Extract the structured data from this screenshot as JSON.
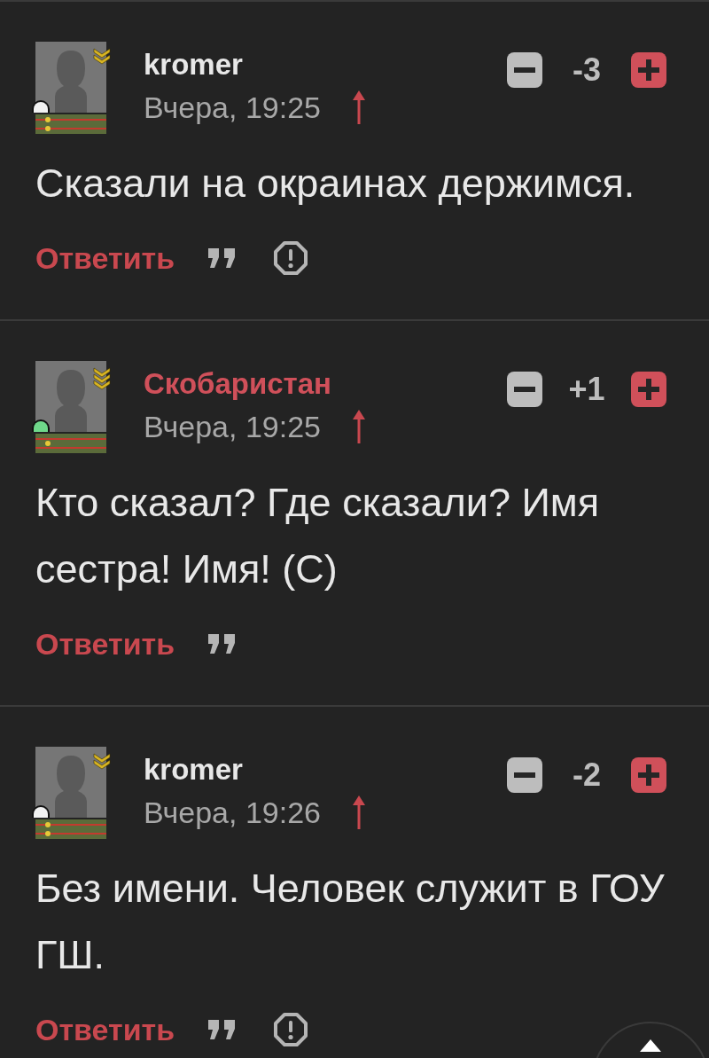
{
  "comments": [
    {
      "author": "kromer",
      "author_is_op": false,
      "time": "Вчера, 19:25",
      "kind": "lieutenant",
      "color": "#f2f2f2",
      "score": "-3",
      "text": "Сказали на окраинах держимся.",
      "reply": "Ответить",
      "report_button": true
    },
    {
      "author": "Скобаристан",
      "author_is_op": true,
      "time": "Вчера, 19:25",
      "kind": "ensign",
      "color": "#6fd88a",
      "score": "+1",
      "text": "Кто сказал? Где сказали? Имя сестра! Имя! (С)",
      "reply": "Ответить",
      "report_button": false
    },
    {
      "author": "kromer",
      "author_is_op": false,
      "time": "Вчера, 19:26",
      "kind": "lieutenant",
      "color": "#f2f2f2",
      "score": "-2",
      "text": "Без имени. Человек служит в ГОУ ГШ.",
      "reply": "Ответить",
      "report_button": true
    }
  ]
}
